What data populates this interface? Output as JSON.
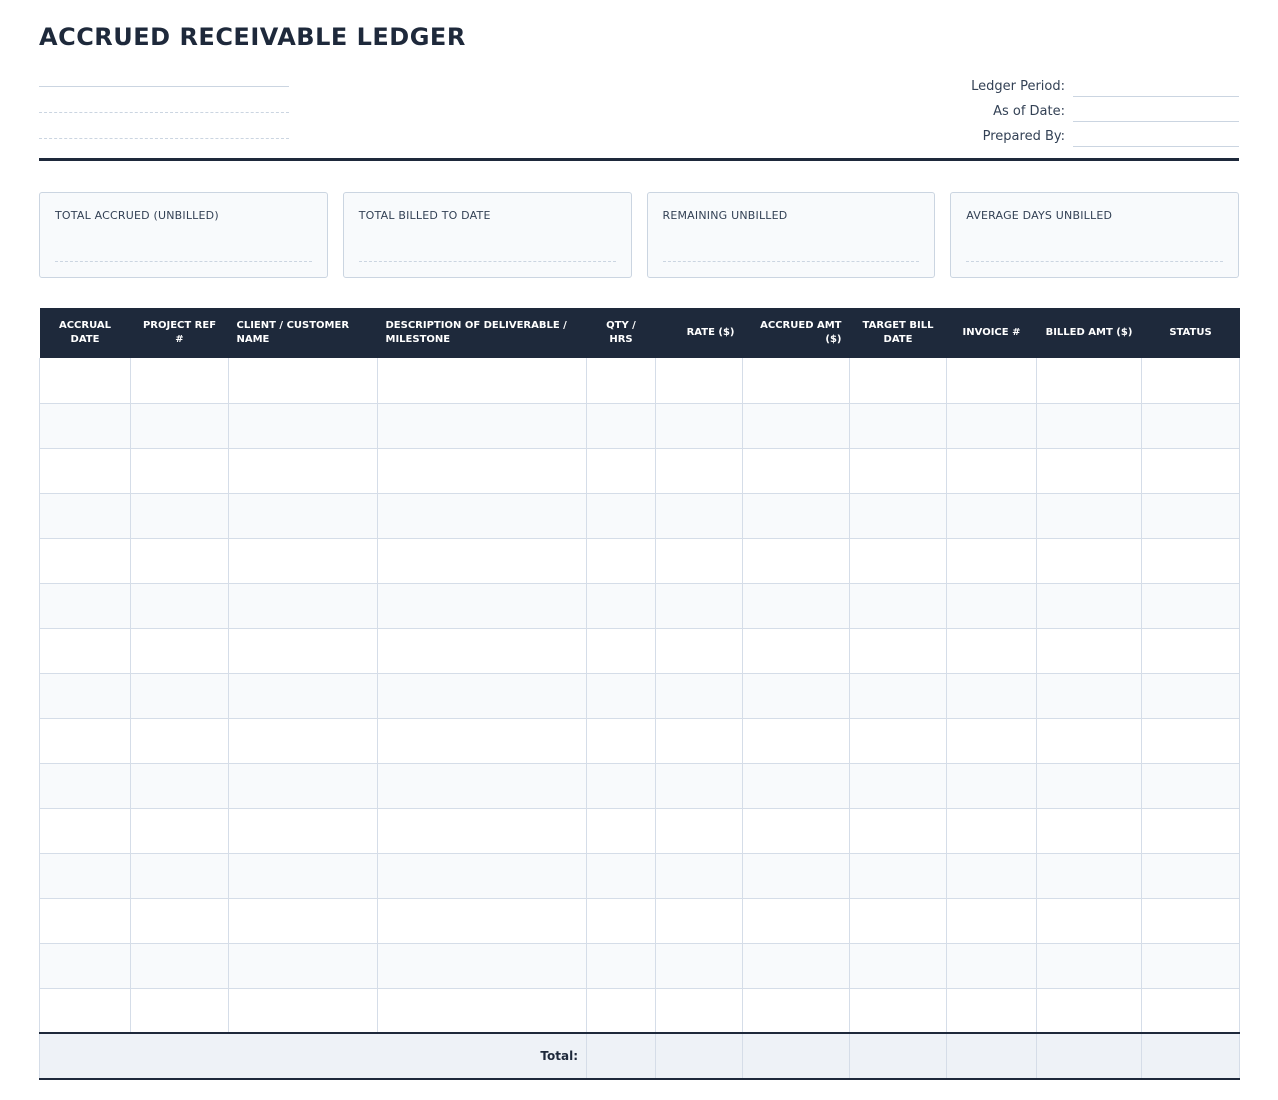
{
  "document": {
    "title": "ACCRUED RECEIVABLE LEDGER"
  },
  "meta": {
    "ledger_period_label": "Ledger Period:",
    "as_of_date_label": "As of Date:",
    "prepared_by_label": "Prepared By:"
  },
  "summary": {
    "cards": [
      {
        "label": "TOTAL ACCRUED (UNBILLED)"
      },
      {
        "label": "TOTAL BILLED TO DATE"
      },
      {
        "label": "REMAINING UNBILLED"
      },
      {
        "label": "AVERAGE DAYS UNBILLED"
      }
    ]
  },
  "table": {
    "columns": [
      {
        "label": "ACCRUAL DATE"
      },
      {
        "label": "PROJECT REF #"
      },
      {
        "label": "CLIENT / CUSTOMER NAME"
      },
      {
        "label": "DESCRIPTION OF DELIVERABLE / MILESTONE"
      },
      {
        "label": "QTY / HRS"
      },
      {
        "label": "RATE ($)"
      },
      {
        "label": "ACCRUED AMT ($)"
      },
      {
        "label": "TARGET BILL DATE"
      },
      {
        "label": "INVOICE #"
      },
      {
        "label": "BILLED AMT ($)"
      },
      {
        "label": "STATUS"
      }
    ],
    "total_label": "Total:"
  }
}
